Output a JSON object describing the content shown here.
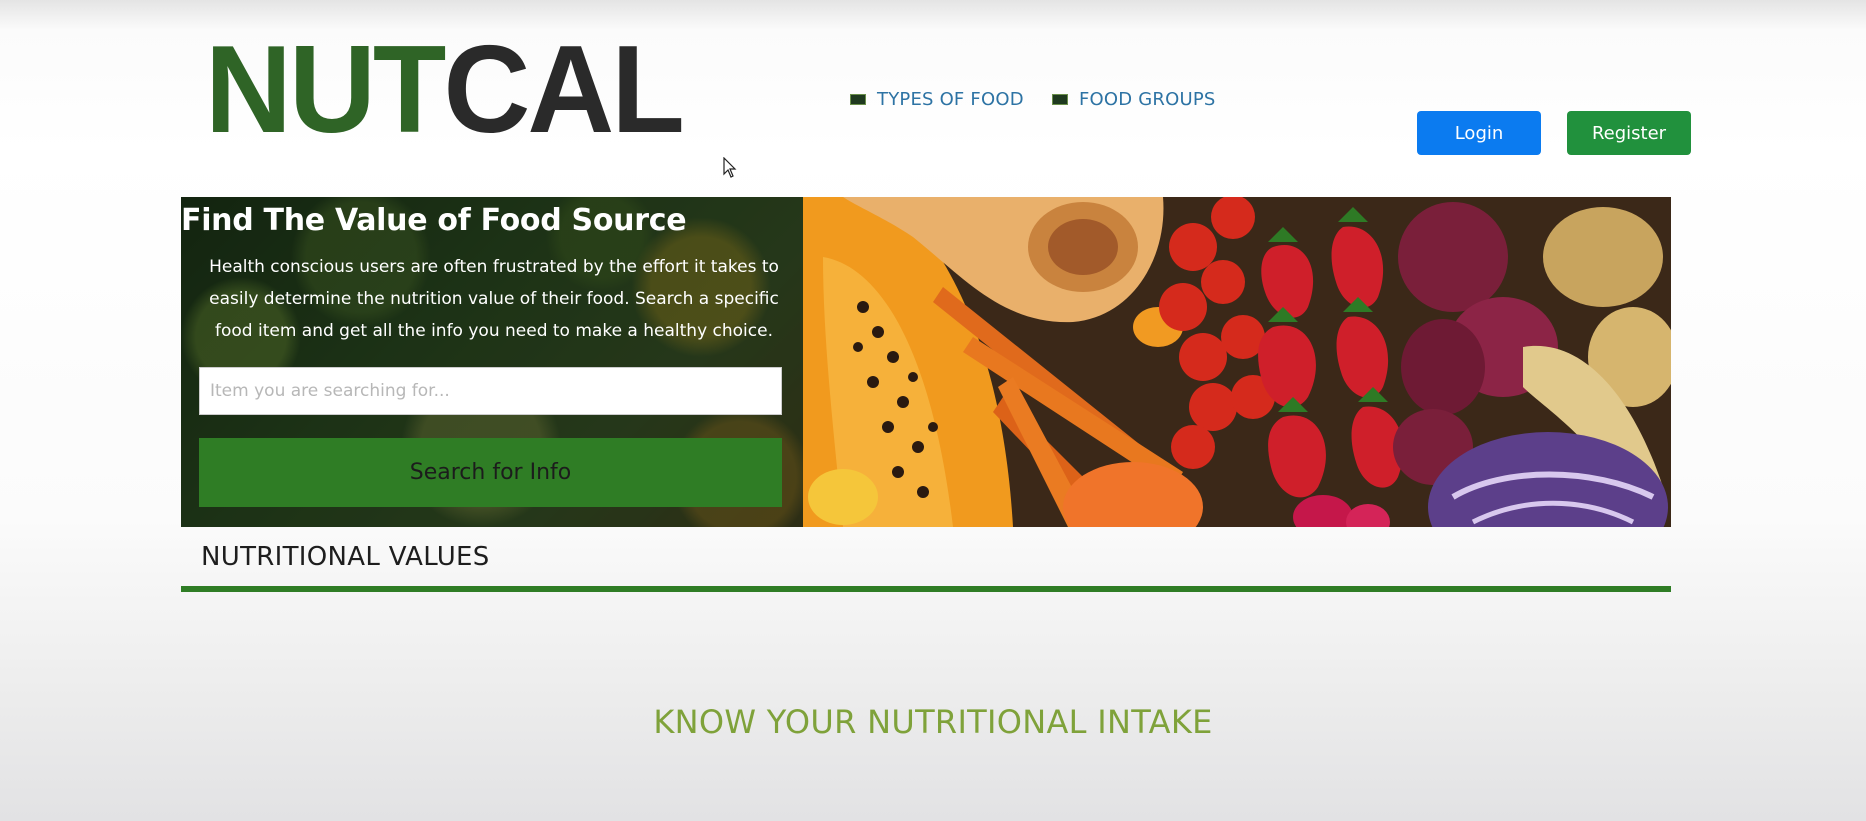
{
  "header": {
    "logo_part1": "NUT",
    "logo_part2": "CAL",
    "nav": [
      {
        "label": "TYPES OF FOOD",
        "icon": "food-flag-icon"
      },
      {
        "label": "FOOD GROUPS",
        "icon": "food-flag-icon"
      }
    ],
    "login_label": "Login",
    "register_label": "Register"
  },
  "hero": {
    "title": "Find The Value of Food Source",
    "description": "Health conscious users are often frustrated by the effort it takes to easily determine the nutrition value of their food. Search a specific food item and get all the info you need to make a healthy choice.",
    "search_placeholder": "Item you are searching for...",
    "search_button_label": "Search for Info",
    "image": "fresh-vegetables-and-fruits-photo"
  },
  "section": {
    "title": "NUTRITIONAL VALUES"
  },
  "tagline": "KNOW YOUR NUTRITIONAL INTAKE",
  "colors": {
    "brand_green": "#2f6426",
    "accent_green": "#2f7d25",
    "login_blue": "#0b7bf0",
    "register_green": "#21913d",
    "nav_link": "#2d73a4",
    "tagline": "#7fa23a"
  }
}
